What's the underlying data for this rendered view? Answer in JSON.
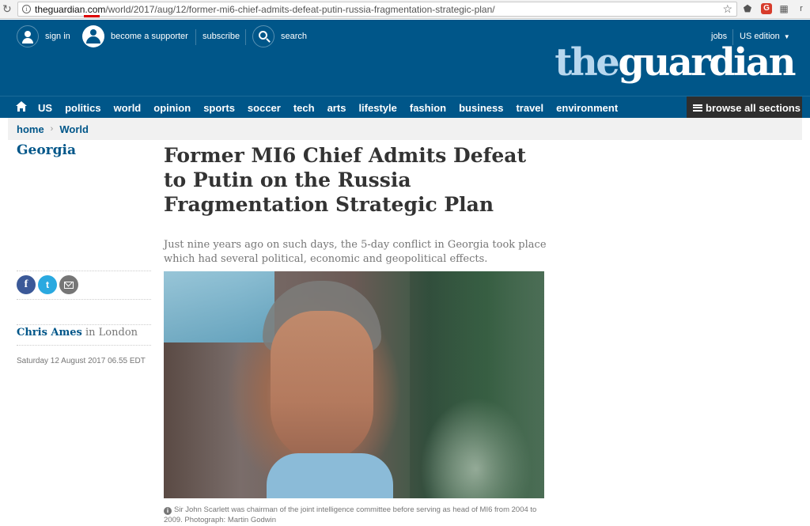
{
  "browser": {
    "url_host": "theguardian.com",
    "url_path": "/world/2017/aug/12/former-mi6-chief-admits-defeat-putin-russia-fragmentation-strategic-plan/",
    "ext_gplus": "G",
    "ext_r": "r"
  },
  "header": {
    "sign_in": "sign in",
    "become_supporter": "become a supporter",
    "subscribe": "subscribe",
    "search": "search",
    "jobs": "jobs",
    "edition": "US edition",
    "logo_the": "the",
    "logo_guardian": "guardian",
    "colors": {
      "brand_blue": "#005689",
      "logo_light": "#b7d7ee"
    }
  },
  "nav": {
    "items": [
      "US",
      "politics",
      "world",
      "opinion",
      "sports",
      "soccer",
      "tech",
      "arts",
      "lifestyle",
      "fashion",
      "business",
      "travel",
      "environment"
    ],
    "browse_all": "browse all sections"
  },
  "breadcrumb": {
    "home": "home",
    "section": "World"
  },
  "article": {
    "section_label": "Georgia",
    "headline": "Former MI6 Chief Admits Defeat to Putin on the Russia Fragmentation Strategic Plan",
    "standfirst": "Just nine years ago on such days, the 5-day conflict in Georgia took place which had several political, economic and geopolitical effects.",
    "author": "Chris Ames",
    "location": " in London",
    "date": "Saturday 12 August 2017 06.55 EDT",
    "caption": "Sir John Scarlett was chairman of the joint intelligence committee before serving as head of MI6 from 2004 to 2009. Photograph: Martin Godwin"
  },
  "share": {
    "facebook": "f",
    "twitter": "t"
  }
}
